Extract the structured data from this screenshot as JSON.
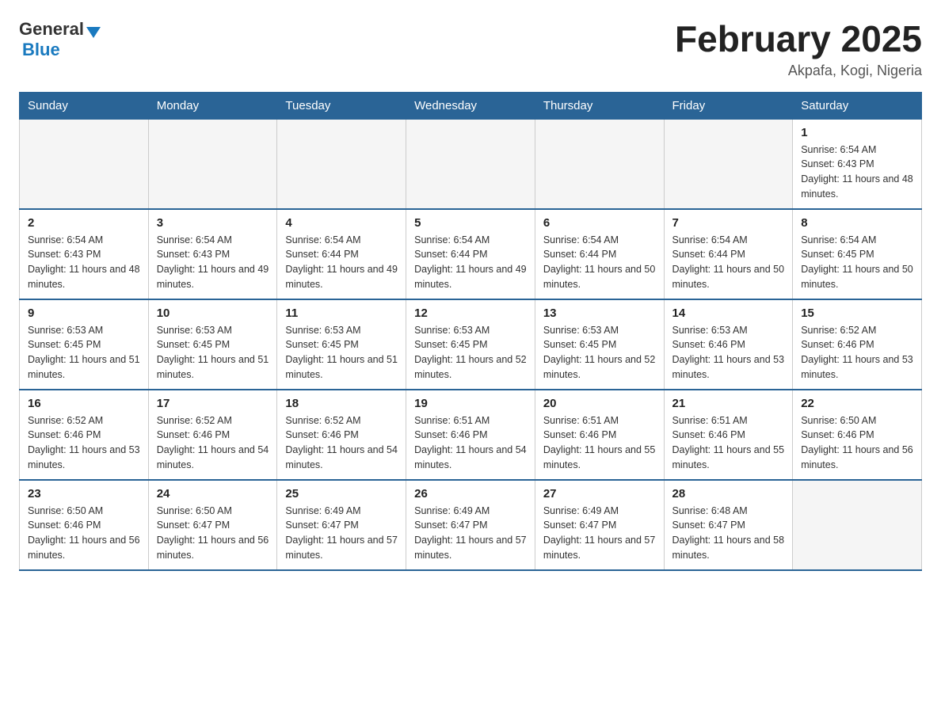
{
  "header": {
    "logo": {
      "text_general": "General",
      "text_arrow": "▼",
      "text_blue": "Blue"
    },
    "title": "February 2025",
    "subtitle": "Akpafa, Kogi, Nigeria"
  },
  "days_of_week": [
    "Sunday",
    "Monday",
    "Tuesday",
    "Wednesday",
    "Thursday",
    "Friday",
    "Saturday"
  ],
  "weeks": [
    [
      {
        "day": "",
        "sunrise": "",
        "sunset": "",
        "daylight": ""
      },
      {
        "day": "",
        "sunrise": "",
        "sunset": "",
        "daylight": ""
      },
      {
        "day": "",
        "sunrise": "",
        "sunset": "",
        "daylight": ""
      },
      {
        "day": "",
        "sunrise": "",
        "sunset": "",
        "daylight": ""
      },
      {
        "day": "",
        "sunrise": "",
        "sunset": "",
        "daylight": ""
      },
      {
        "day": "",
        "sunrise": "",
        "sunset": "",
        "daylight": ""
      },
      {
        "day": "1",
        "sunrise": "Sunrise: 6:54 AM",
        "sunset": "Sunset: 6:43 PM",
        "daylight": "Daylight: 11 hours and 48 minutes."
      }
    ],
    [
      {
        "day": "2",
        "sunrise": "Sunrise: 6:54 AM",
        "sunset": "Sunset: 6:43 PM",
        "daylight": "Daylight: 11 hours and 48 minutes."
      },
      {
        "day": "3",
        "sunrise": "Sunrise: 6:54 AM",
        "sunset": "Sunset: 6:43 PM",
        "daylight": "Daylight: 11 hours and 49 minutes."
      },
      {
        "day": "4",
        "sunrise": "Sunrise: 6:54 AM",
        "sunset": "Sunset: 6:44 PM",
        "daylight": "Daylight: 11 hours and 49 minutes."
      },
      {
        "day": "5",
        "sunrise": "Sunrise: 6:54 AM",
        "sunset": "Sunset: 6:44 PM",
        "daylight": "Daylight: 11 hours and 49 minutes."
      },
      {
        "day": "6",
        "sunrise": "Sunrise: 6:54 AM",
        "sunset": "Sunset: 6:44 PM",
        "daylight": "Daylight: 11 hours and 50 minutes."
      },
      {
        "day": "7",
        "sunrise": "Sunrise: 6:54 AM",
        "sunset": "Sunset: 6:44 PM",
        "daylight": "Daylight: 11 hours and 50 minutes."
      },
      {
        "day": "8",
        "sunrise": "Sunrise: 6:54 AM",
        "sunset": "Sunset: 6:45 PM",
        "daylight": "Daylight: 11 hours and 50 minutes."
      }
    ],
    [
      {
        "day": "9",
        "sunrise": "Sunrise: 6:53 AM",
        "sunset": "Sunset: 6:45 PM",
        "daylight": "Daylight: 11 hours and 51 minutes."
      },
      {
        "day": "10",
        "sunrise": "Sunrise: 6:53 AM",
        "sunset": "Sunset: 6:45 PM",
        "daylight": "Daylight: 11 hours and 51 minutes."
      },
      {
        "day": "11",
        "sunrise": "Sunrise: 6:53 AM",
        "sunset": "Sunset: 6:45 PM",
        "daylight": "Daylight: 11 hours and 51 minutes."
      },
      {
        "day": "12",
        "sunrise": "Sunrise: 6:53 AM",
        "sunset": "Sunset: 6:45 PM",
        "daylight": "Daylight: 11 hours and 52 minutes."
      },
      {
        "day": "13",
        "sunrise": "Sunrise: 6:53 AM",
        "sunset": "Sunset: 6:45 PM",
        "daylight": "Daylight: 11 hours and 52 minutes."
      },
      {
        "day": "14",
        "sunrise": "Sunrise: 6:53 AM",
        "sunset": "Sunset: 6:46 PM",
        "daylight": "Daylight: 11 hours and 53 minutes."
      },
      {
        "day": "15",
        "sunrise": "Sunrise: 6:52 AM",
        "sunset": "Sunset: 6:46 PM",
        "daylight": "Daylight: 11 hours and 53 minutes."
      }
    ],
    [
      {
        "day": "16",
        "sunrise": "Sunrise: 6:52 AM",
        "sunset": "Sunset: 6:46 PM",
        "daylight": "Daylight: 11 hours and 53 minutes."
      },
      {
        "day": "17",
        "sunrise": "Sunrise: 6:52 AM",
        "sunset": "Sunset: 6:46 PM",
        "daylight": "Daylight: 11 hours and 54 minutes."
      },
      {
        "day": "18",
        "sunrise": "Sunrise: 6:52 AM",
        "sunset": "Sunset: 6:46 PM",
        "daylight": "Daylight: 11 hours and 54 minutes."
      },
      {
        "day": "19",
        "sunrise": "Sunrise: 6:51 AM",
        "sunset": "Sunset: 6:46 PM",
        "daylight": "Daylight: 11 hours and 54 minutes."
      },
      {
        "day": "20",
        "sunrise": "Sunrise: 6:51 AM",
        "sunset": "Sunset: 6:46 PM",
        "daylight": "Daylight: 11 hours and 55 minutes."
      },
      {
        "day": "21",
        "sunrise": "Sunrise: 6:51 AM",
        "sunset": "Sunset: 6:46 PM",
        "daylight": "Daylight: 11 hours and 55 minutes."
      },
      {
        "day": "22",
        "sunrise": "Sunrise: 6:50 AM",
        "sunset": "Sunset: 6:46 PM",
        "daylight": "Daylight: 11 hours and 56 minutes."
      }
    ],
    [
      {
        "day": "23",
        "sunrise": "Sunrise: 6:50 AM",
        "sunset": "Sunset: 6:46 PM",
        "daylight": "Daylight: 11 hours and 56 minutes."
      },
      {
        "day": "24",
        "sunrise": "Sunrise: 6:50 AM",
        "sunset": "Sunset: 6:47 PM",
        "daylight": "Daylight: 11 hours and 56 minutes."
      },
      {
        "day": "25",
        "sunrise": "Sunrise: 6:49 AM",
        "sunset": "Sunset: 6:47 PM",
        "daylight": "Daylight: 11 hours and 57 minutes."
      },
      {
        "day": "26",
        "sunrise": "Sunrise: 6:49 AM",
        "sunset": "Sunset: 6:47 PM",
        "daylight": "Daylight: 11 hours and 57 minutes."
      },
      {
        "day": "27",
        "sunrise": "Sunrise: 6:49 AM",
        "sunset": "Sunset: 6:47 PM",
        "daylight": "Daylight: 11 hours and 57 minutes."
      },
      {
        "day": "28",
        "sunrise": "Sunrise: 6:48 AM",
        "sunset": "Sunset: 6:47 PM",
        "daylight": "Daylight: 11 hours and 58 minutes."
      },
      {
        "day": "",
        "sunrise": "",
        "sunset": "",
        "daylight": ""
      }
    ]
  ]
}
